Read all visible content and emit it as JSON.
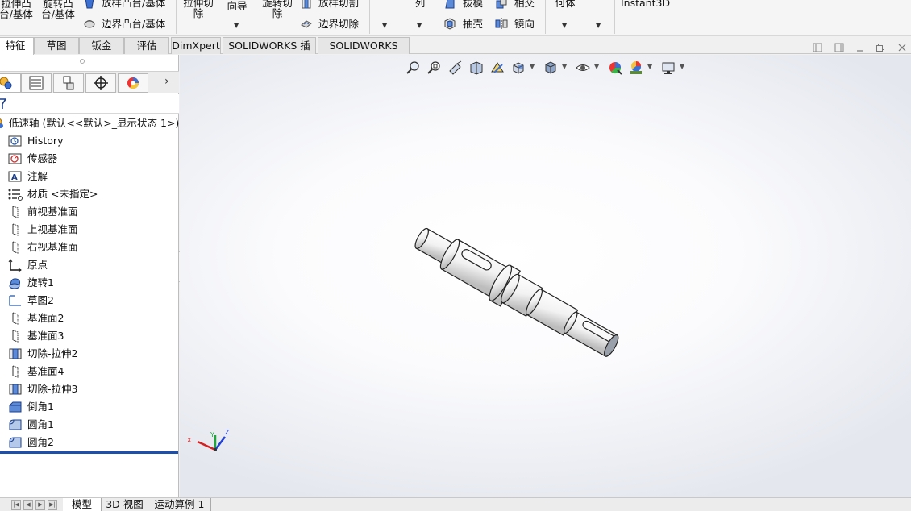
{
  "ribbon": {
    "extrude_boss_l1": "拉伸凸",
    "extrude_boss_l2": "台/基体",
    "revolve_boss_l1": "旋转凸",
    "revolve_boss_l2": "台/基体",
    "loft_boss": "放样凸台/基体",
    "boundary_boss": "边界凸台/基体",
    "extrude_cut_l1": "拉伸切",
    "extrude_cut_l2": "除",
    "hole_wizard_l2": "向导",
    "revolve_cut_l1": "旋转切",
    "revolve_cut_l2": "除",
    "loft_cut": "放样切割",
    "boundary_cut": "边界切除",
    "pattern_l2": "列",
    "draft": "拔模",
    "shell": "抽壳",
    "intersect": "相交",
    "mirror": "镜向",
    "ref_geometry_l2": "何体",
    "instant3d": "Instant3D"
  },
  "tabs": [
    "特征",
    "草图",
    "钣金",
    "评估",
    "DimXpert",
    "SOLIDWORKS 插件",
    "SOLIDWORKS MBD"
  ],
  "active_tab": "特征",
  "tree": {
    "root": "低速轴 (默认<<默认>_显示状态 1>)",
    "items": [
      {
        "label": "History",
        "icon": "history-icon"
      },
      {
        "label": "传感器",
        "icon": "sensor-icon"
      },
      {
        "label": "注解",
        "icon": "annotation-icon"
      },
      {
        "label": "材质 <未指定>",
        "icon": "material-icon"
      },
      {
        "label": "前视基准面",
        "icon": "plane-icon"
      },
      {
        "label": "上视基准面",
        "icon": "plane-icon"
      },
      {
        "label": "右视基准面",
        "icon": "plane-icon"
      },
      {
        "label": "原点",
        "icon": "origin-icon"
      },
      {
        "label": "旋转1",
        "icon": "revolve-feature-icon"
      },
      {
        "label": "草图2",
        "icon": "sketch-icon"
      },
      {
        "label": "基准面2",
        "icon": "plane-icon"
      },
      {
        "label": "基准面3",
        "icon": "plane-icon"
      },
      {
        "label": "切除-拉伸2",
        "icon": "cut-extrude-icon"
      },
      {
        "label": "基准面4",
        "icon": "plane-icon"
      },
      {
        "label": "切除-拉伸3",
        "icon": "cut-extrude-icon"
      },
      {
        "label": "倒角1",
        "icon": "chamfer-icon"
      },
      {
        "label": "圆角1",
        "icon": "fillet-icon"
      },
      {
        "label": "圆角2",
        "icon": "fillet-icon"
      }
    ]
  },
  "triad": {
    "x": "X",
    "y": "Y",
    "z": "Z"
  },
  "bottom_tabs": [
    "模型",
    "3D 视图",
    "运动算例 1"
  ],
  "active_bottom_tab": "模型",
  "colors": {
    "accent": "#1d4fae",
    "panel_bg": "#ffffff",
    "tab_bg": "#e6e6e6"
  }
}
